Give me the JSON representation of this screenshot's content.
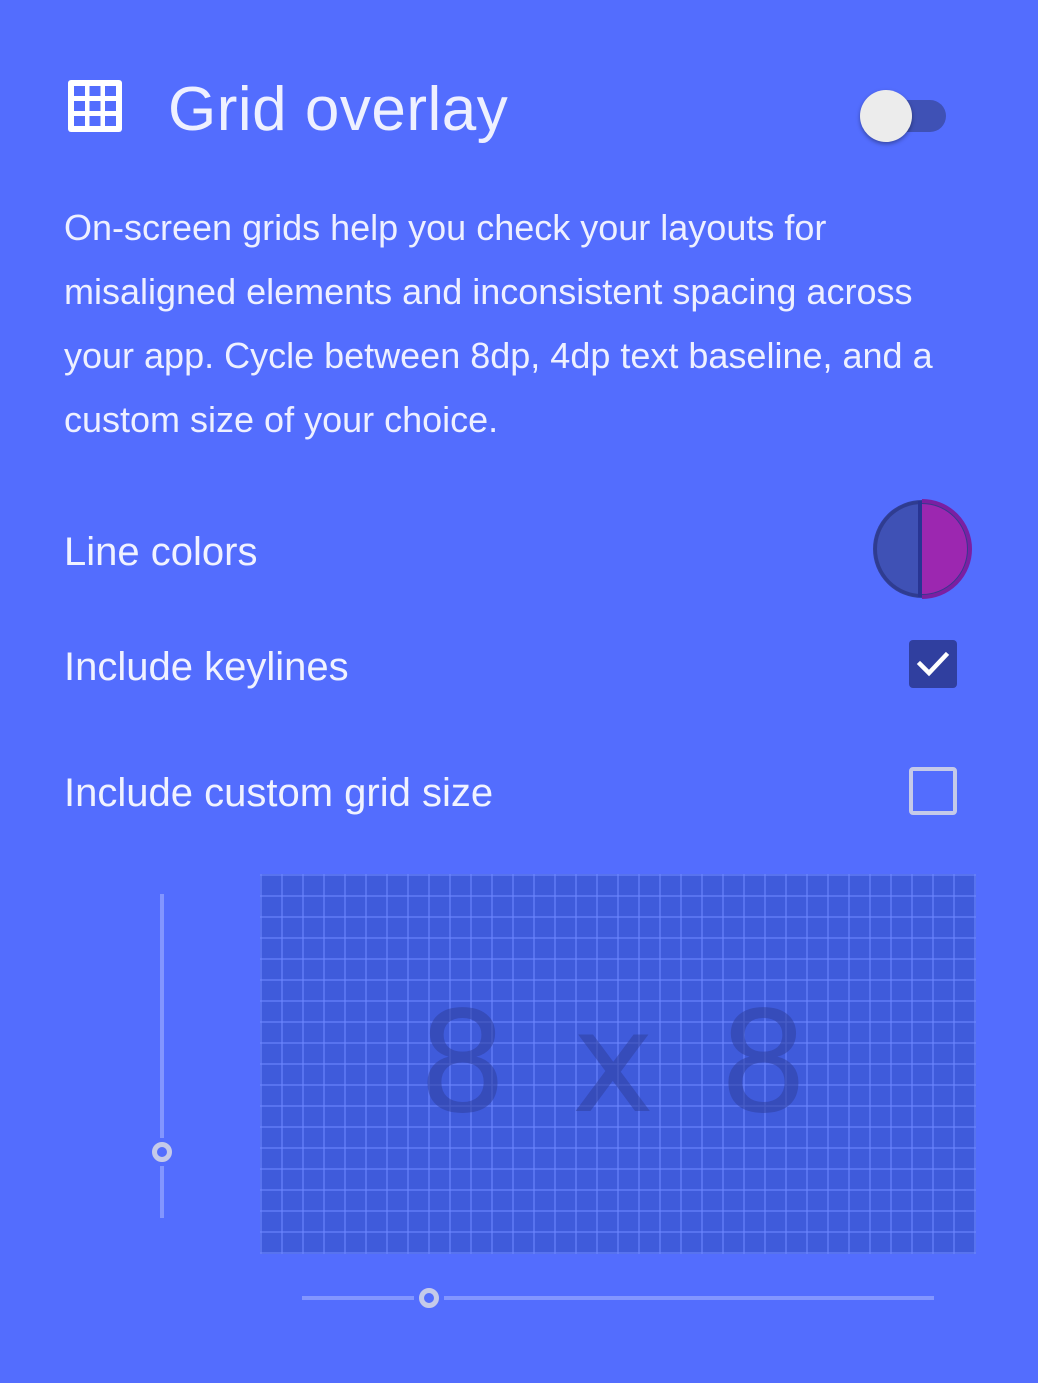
{
  "header": {
    "icon": "grid-icon",
    "title": "Grid overlay",
    "toggle_on": false
  },
  "description": "On-screen grids help you check your layouts for misaligned elements and inconsistent spacing across your app. Cycle between 8dp, 4dp text baseline, and a custom size of your choice.",
  "settings": {
    "line_colors": {
      "label": "Line colors",
      "colors": [
        "#3f51b5",
        "#9c27b0"
      ]
    },
    "keylines": {
      "label": "Include keylines",
      "checked": true
    },
    "custom_grid": {
      "label": "Include custom grid size",
      "checked": false
    }
  },
  "preview": {
    "grid_size_label": "8 x 8"
  },
  "colors": {
    "background": "#536dfe",
    "accent_dark": "#303f9f",
    "primary": "#3f51b5",
    "magenta": "#9c27b0"
  }
}
